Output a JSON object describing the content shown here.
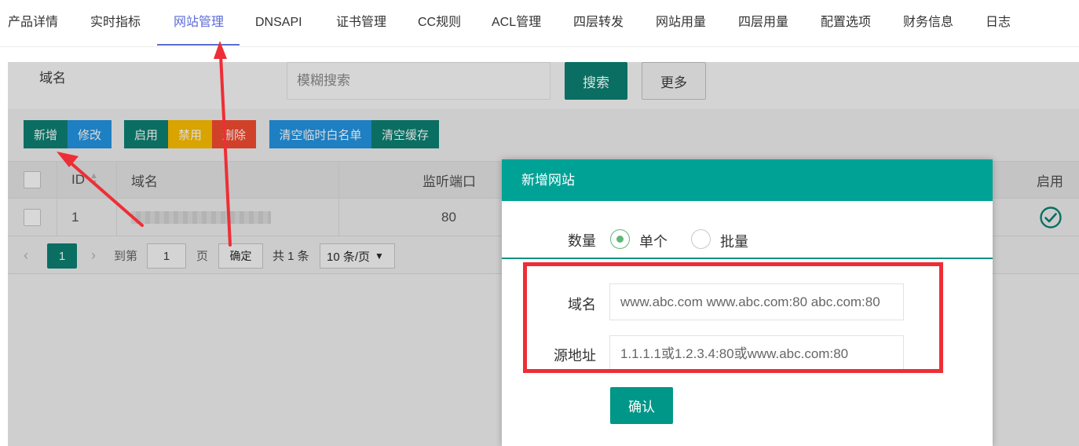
{
  "tabs": [
    "产品详情",
    "实时指标",
    "网站管理",
    "DNSAPI",
    "证书管理",
    "CC规则",
    "ACL管理",
    "四层转发",
    "网站用量",
    "四层用量",
    "配置选项",
    "财务信息",
    "日志"
  ],
  "active_tab": "网站管理",
  "search": {
    "label": "域名",
    "placeholder": "模糊搜索",
    "search_button": "搜索",
    "more_button": "更多"
  },
  "toolbar": {
    "add": "新增",
    "edit": "修改",
    "enable": "启用",
    "disable": "禁用",
    "delete": "删除",
    "clear_whitelist": "清空临时白名单",
    "clear_cache": "清空缓存"
  },
  "table": {
    "columns": {
      "id": "ID",
      "domain": "域名",
      "port": "监听端口",
      "enabled": "启用"
    },
    "rows": [
      {
        "id": "1",
        "port": "80"
      }
    ]
  },
  "pager": {
    "current": "1",
    "goto_label": "到第",
    "page_input": "1",
    "page_unit": "页",
    "confirm": "确定",
    "total": "共 1 条",
    "per_page": "10 条/页"
  },
  "modal": {
    "title": "新增网站",
    "quantity_label": "数量",
    "option_single": "单个",
    "option_batch": "批量",
    "domain_label": "域名",
    "domain_placeholder": "www.abc.com www.abc.com:80 abc.com:80",
    "source_label": "源地址",
    "source_placeholder": "1.1.1.1或1.2.3.4:80或www.abc.com:80",
    "confirm": "确认"
  },
  "colors": {
    "teal": "#009688",
    "dark_teal": "#0b6e62",
    "active_tab": "#5c6bd6",
    "annotation": "#ee2e36",
    "blue_btn": "#1e7fc2",
    "yellow_btn": "#d9a300",
    "red_btn": "#d1412a"
  }
}
